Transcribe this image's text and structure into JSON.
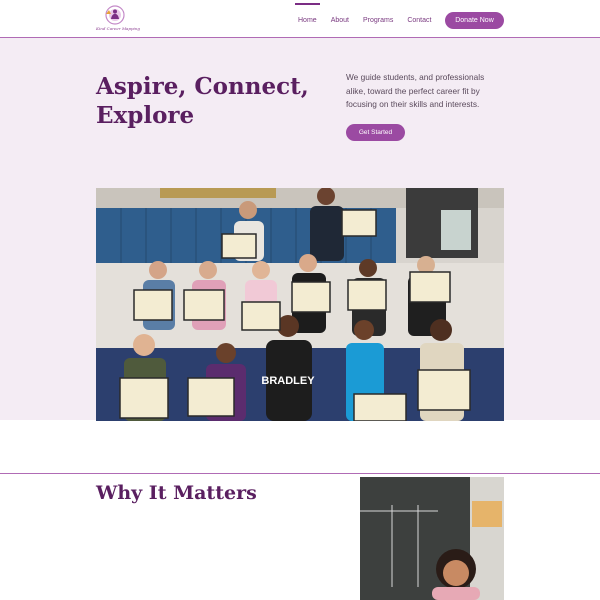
{
  "header": {
    "logo_tagline": "Kind Career Mapping",
    "nav": [
      "Home",
      "About",
      "Programs",
      "Contact"
    ],
    "active_nav": "Home",
    "donate_label": "Donate Now"
  },
  "hero": {
    "title": "Aspire, Connect, Explore",
    "text": "We guide students, and professionals alike, toward the perfect career fit by focusing on their skills and interests.",
    "cta_label": "Get Started"
  },
  "why": {
    "title": "Why It Matters"
  },
  "colors": {
    "brand_purple": "#9b4aa2",
    "title_purple": "#5a1f60",
    "hero_bg": "#f4ecf4"
  }
}
